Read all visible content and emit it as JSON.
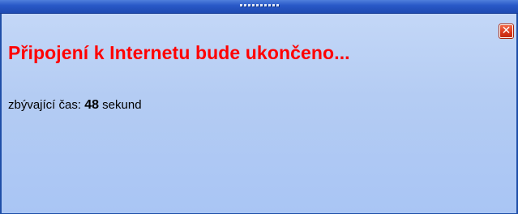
{
  "window": {
    "close_glyph": "✕",
    "close_icon": "close-icon"
  },
  "message": {
    "headline": "Připojení k Internetu bude ukončeno...",
    "remaining_label": "zbývající čas:",
    "remaining_value": "48",
    "remaining_unit": "sekund"
  },
  "colors": {
    "headline": "#ff0000",
    "titlebar": "#2a5ac8",
    "background": "#b4ccf3",
    "close_button": "#d9361a"
  }
}
